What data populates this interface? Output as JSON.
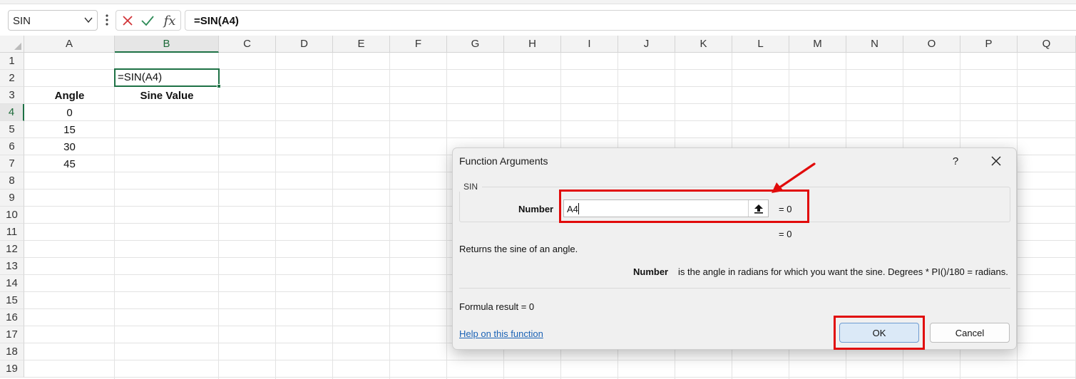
{
  "formula_bar": {
    "name_box": "SIN",
    "cancel_icon": "x-icon",
    "enter_icon": "checkmark-icon",
    "fx_label": "fx",
    "formula": "=SIN(A4)"
  },
  "columns": [
    "A",
    "B",
    "C",
    "D",
    "E",
    "F",
    "G",
    "H",
    "I",
    "J",
    "K",
    "L",
    "M",
    "N",
    "O",
    "P",
    "Q"
  ],
  "rows": [
    "1",
    "2",
    "3",
    "4",
    "5",
    "6",
    "7",
    "8",
    "9",
    "10",
    "11",
    "12",
    "13",
    "14",
    "15",
    "16",
    "17",
    "18",
    "19"
  ],
  "selected_column": "B",
  "selected_row": "4",
  "cells": {
    "A3": "Angle",
    "B3": "Sine Value",
    "A4": "0",
    "B4": "=SIN(A4)",
    "A5": "15",
    "A6": "30",
    "A7": "45"
  },
  "dialog": {
    "title": "Function Arguments",
    "help_glyph": "?",
    "close_icon": "close-icon",
    "function_name": "SIN",
    "arg_label": "Number",
    "arg_value": "A4",
    "arg_eval": "=   0",
    "result_eval": "=   0",
    "description": "Returns the sine of an angle.",
    "arg_desc_name": "Number",
    "arg_desc_text": "is the angle in radians for which you want the sine. Degrees * PI()/180 = radians.",
    "formula_result": "Formula result =    0",
    "help_link": "Help on this function",
    "ok_label": "OK",
    "cancel_label": "Cancel"
  },
  "annotation_color": "#e10b0b",
  "selection_color": "#1e7145"
}
